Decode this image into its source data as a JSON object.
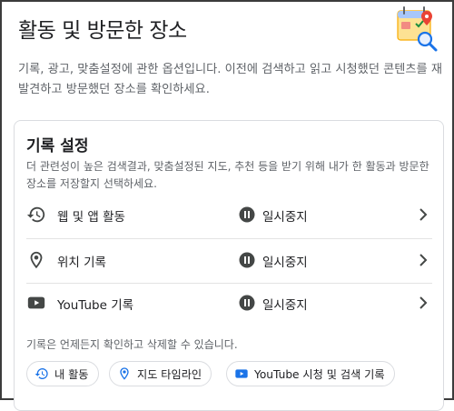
{
  "header": {
    "title": "활동 및 방문한 장소",
    "intro": "기록, 광고, 맞춤설정에 관한 옵션입니다. 이전에 검색하고 읽고 시청했던 콘텐츠를 재발견하고 방문했던 장소를 확인하세요."
  },
  "history": {
    "title": "기록 설정",
    "description": "더 관련성이 높은 검색결과, 맞춤설정된 지도, 추천 등을 받기 위해 내가 한 활동과 방문한 장소를 저장할지 선택하세요.",
    "rows": [
      {
        "icon": "history-icon",
        "label": "웹 및 앱 활동",
        "status": "일시중지"
      },
      {
        "icon": "location-pin-icon",
        "label": "위치 기록",
        "status": "일시중지"
      },
      {
        "icon": "youtube-icon",
        "label": "YouTube 기록",
        "status": "일시중지"
      }
    ],
    "note": "기록은 언제든지 확인하고 삭제할 수 있습니다.",
    "chips": [
      {
        "icon": "history-icon",
        "label": "내 활동"
      },
      {
        "icon": "location-pin-icon",
        "label": "지도 타임라인"
      },
      {
        "icon": "youtube-icon",
        "label": "YouTube 시청 및 검색 기록"
      }
    ]
  },
  "colors": {
    "youtube_red": "#c4302b",
    "youtube_blue": "#1a73e8",
    "text_primary": "#202124",
    "text_secondary": "#5f6368",
    "divider": "#e3e3e3"
  }
}
